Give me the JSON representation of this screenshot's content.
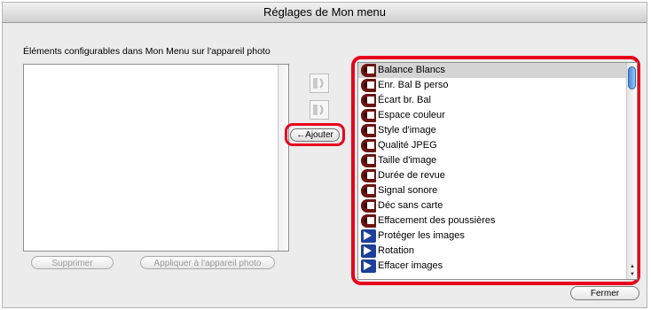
{
  "window": {
    "title": "Réglages de Mon menu"
  },
  "left_panel": {
    "label": "Éléments configurables dans Mon Menu sur l'appareil photo",
    "delete_button": "Supprimer",
    "apply_button": "Appliquer à l'appareil photo"
  },
  "middle": {
    "add_button": "←Ajouter",
    "move_up_icon": "move-up-icon",
    "move_down_icon": "move-down-icon"
  },
  "right_list": {
    "items": [
      {
        "label": "Balance Blancs",
        "icon": "shooting-menu-icon",
        "selected": true
      },
      {
        "label": "Enr. Bal B perso",
        "icon": "shooting-menu-icon"
      },
      {
        "label": "Écart br. Bal",
        "icon": "shooting-menu-icon"
      },
      {
        "label": "Espace couleur",
        "icon": "shooting-menu-icon"
      },
      {
        "label": "Style d'image",
        "icon": "shooting-menu-icon"
      },
      {
        "label": "Qualité JPEG",
        "icon": "shooting-menu-icon"
      },
      {
        "label": "Taille d'image",
        "icon": "shooting-menu-icon"
      },
      {
        "label": "Durée de revue",
        "icon": "shooting-menu-icon"
      },
      {
        "label": "Signal sonore",
        "icon": "shooting-menu-icon"
      },
      {
        "label": "Déc sans carte",
        "icon": "shooting-menu-icon"
      },
      {
        "label": "Effacement des poussières",
        "icon": "shooting-menu-icon"
      },
      {
        "label": "Protéger les images",
        "icon": "playback-menu-icon"
      },
      {
        "label": "Rotation",
        "icon": "playback-menu-icon"
      },
      {
        "label": "Effacer images",
        "icon": "playback-menu-icon"
      }
    ]
  },
  "footer": {
    "close_button": "Fermer"
  },
  "colors": {
    "highlight": "#e8001c",
    "shooting_icon": "#6b1410",
    "playback_icon": "#1c3f9a"
  }
}
